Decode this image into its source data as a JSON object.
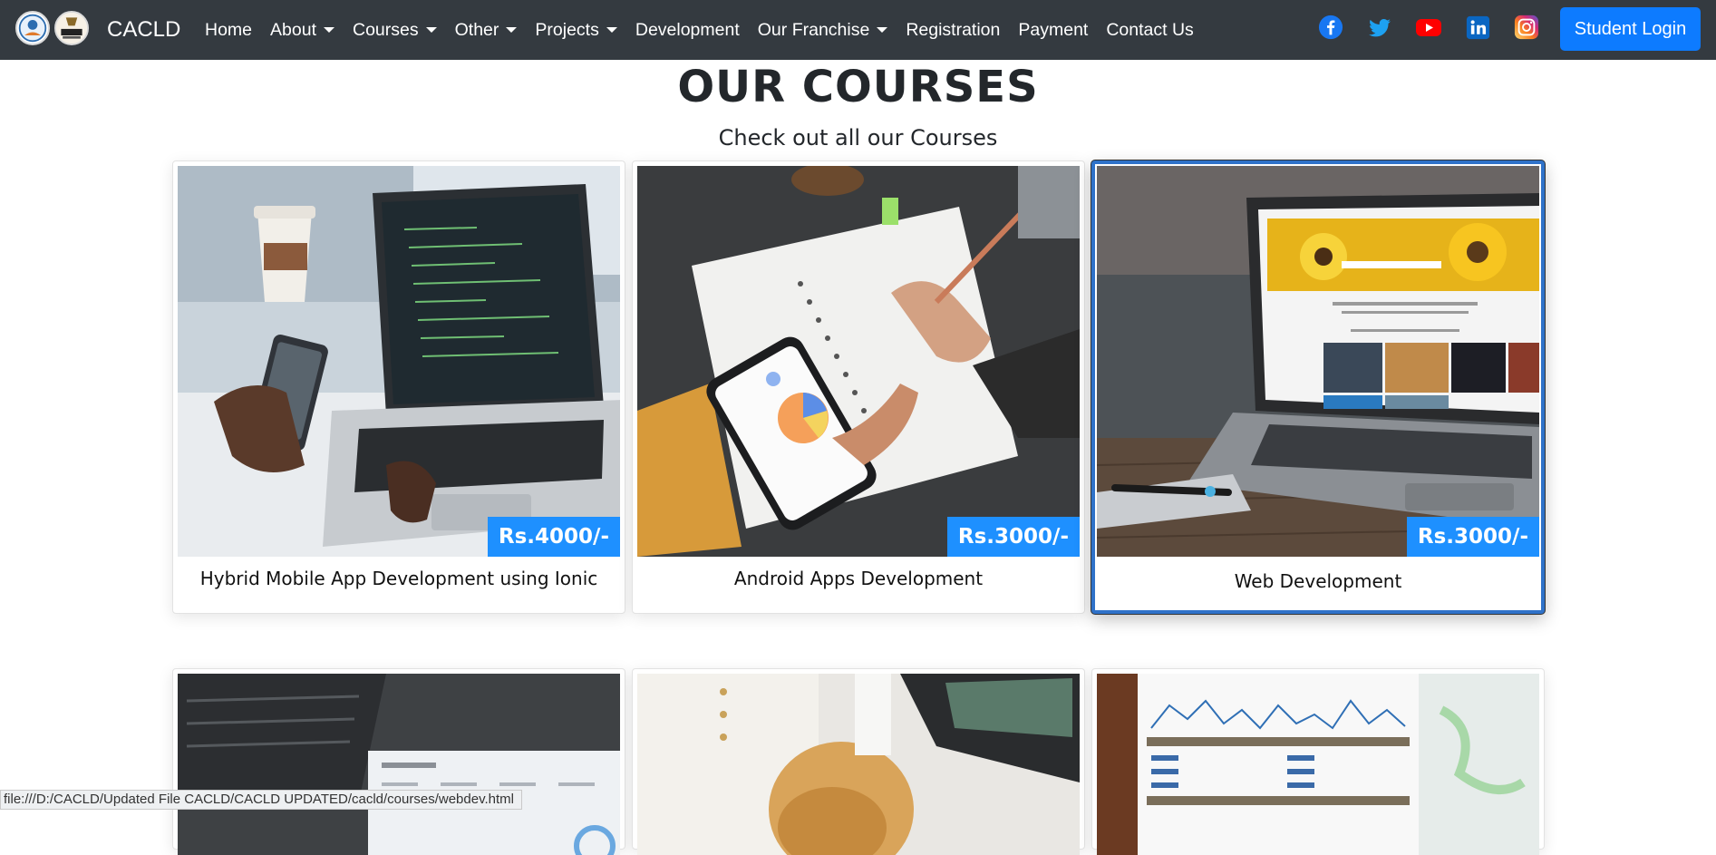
{
  "navbar": {
    "brand": "CACLD",
    "items": [
      {
        "label": "Home",
        "dropdown": false
      },
      {
        "label": "About",
        "dropdown": true
      },
      {
        "label": "Courses",
        "dropdown": true
      },
      {
        "label": "Other",
        "dropdown": true
      },
      {
        "label": "Projects",
        "dropdown": true
      },
      {
        "label": "Development",
        "dropdown": false
      },
      {
        "label": "Our Franchise",
        "dropdown": true
      },
      {
        "label": "Registration",
        "dropdown": false
      },
      {
        "label": "Payment",
        "dropdown": false
      },
      {
        "label": "Contact Us",
        "dropdown": false
      }
    ],
    "social_icons": [
      "facebook-icon",
      "twitter-icon",
      "youtube-icon",
      "linkedin-icon",
      "instagram-icon"
    ],
    "login_label": "Student Login"
  },
  "main": {
    "title": "OUR COURSES",
    "subtitle": "Check out all our Courses",
    "courses": [
      {
        "title": "Hybrid Mobile App Development using Ionic",
        "price": "Rs.4000/-"
      },
      {
        "title": "Android Apps Development",
        "price": "Rs.3000/-"
      },
      {
        "title": "Web Development",
        "price": "Rs.3000/-"
      }
    ]
  },
  "status_bar": {
    "url": "file:///D:/CACLD/Updated File CACLD/CACLD UPDATED/cacld/courses/webdev.html"
  },
  "colors": {
    "navbar_bg": "#343a40",
    "primary": "#0d7bff",
    "price_badge": "#1e90ff",
    "active_border": "#2f72c9"
  }
}
